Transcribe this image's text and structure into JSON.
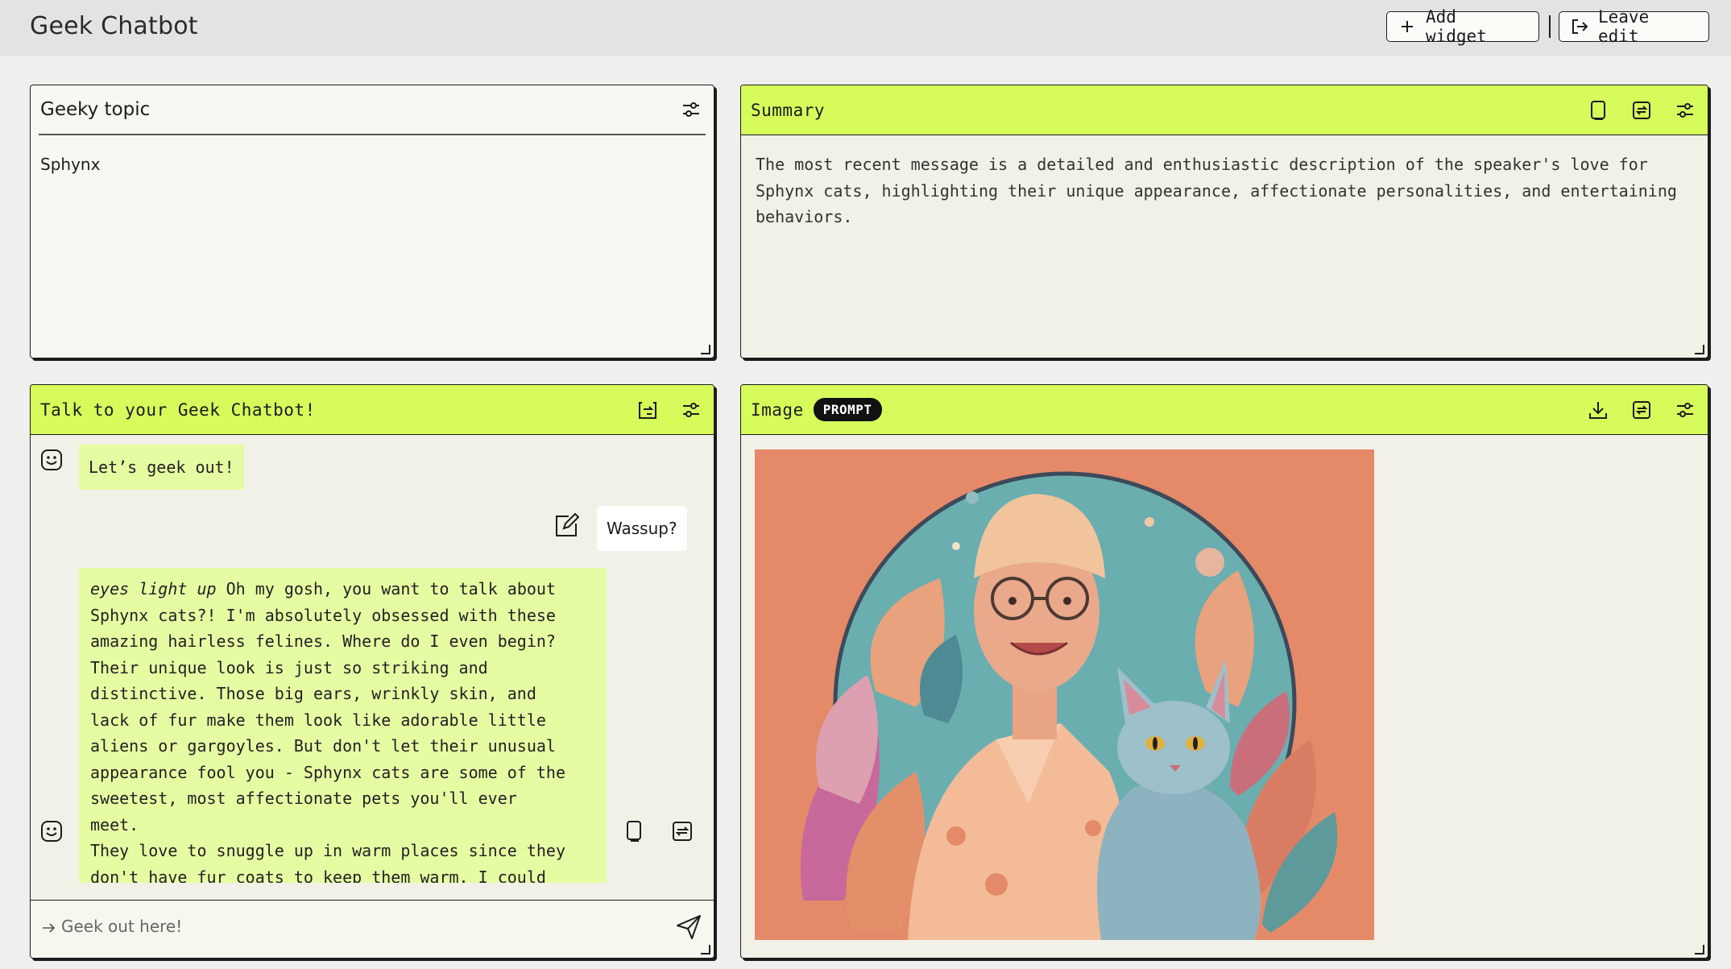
{
  "app": {
    "title": "Geek Chatbot"
  },
  "toolbar": {
    "add_widget_label": "Add widget",
    "leave_edit_label": "Leave edit"
  },
  "topic_panel": {
    "title": "Geeky topic",
    "value": "Sphynx"
  },
  "summary_panel": {
    "title": "Summary",
    "text": "The most recent message is a detailed and enthusiastic description of the speaker's love for Sphynx cats, highlighting their unique appearance, affectionate personalities, and entertaining behaviors."
  },
  "chat_panel": {
    "title": "Talk to your Geek Chatbot!",
    "messages": [
      {
        "role": "bot",
        "text": "Let’s geek out!"
      },
      {
        "role": "user",
        "text": "Wassup?"
      },
      {
        "role": "bot",
        "emphasis": "eyes light up",
        "lines": [
          " Oh my gosh, you want to talk about",
          "Sphynx cats?! I'm absolutely obsessed with these",
          "amazing hairless felines. Where do I even begin?",
          "Their unique look is just so striking and",
          "distinctive. Those big ears, wrinkly skin, and",
          "lack of fur make them look like adorable little",
          "aliens or gargoyles. But don't let their unusual",
          "appearance fool you - Sphynx cats are some of the",
          "sweetest, most affectionate pets you'll ever",
          "meet.",
          "They love to snuggle up in warm places since they",
          "don't have fur coats to keep them warm. I could"
        ]
      }
    ],
    "input_placeholder": "Geek out here!"
  },
  "image_panel": {
    "title": "Image",
    "badge": "PROMPT"
  },
  "icons": {
    "add": "plus-icon",
    "leave": "exit-icon",
    "settings": "sliders-icon",
    "copy": "copy-icon",
    "regenerate": "refresh-icon",
    "download": "download-icon",
    "edit": "edit-icon",
    "export": "export-icon",
    "send": "send-icon",
    "avatar": "smiley-icon"
  },
  "colors": {
    "accent": "#d6fb5b",
    "bot_bubble": "#e6fca3",
    "panel_bg": "#f2f1e7",
    "page_bg": "#efefee"
  }
}
